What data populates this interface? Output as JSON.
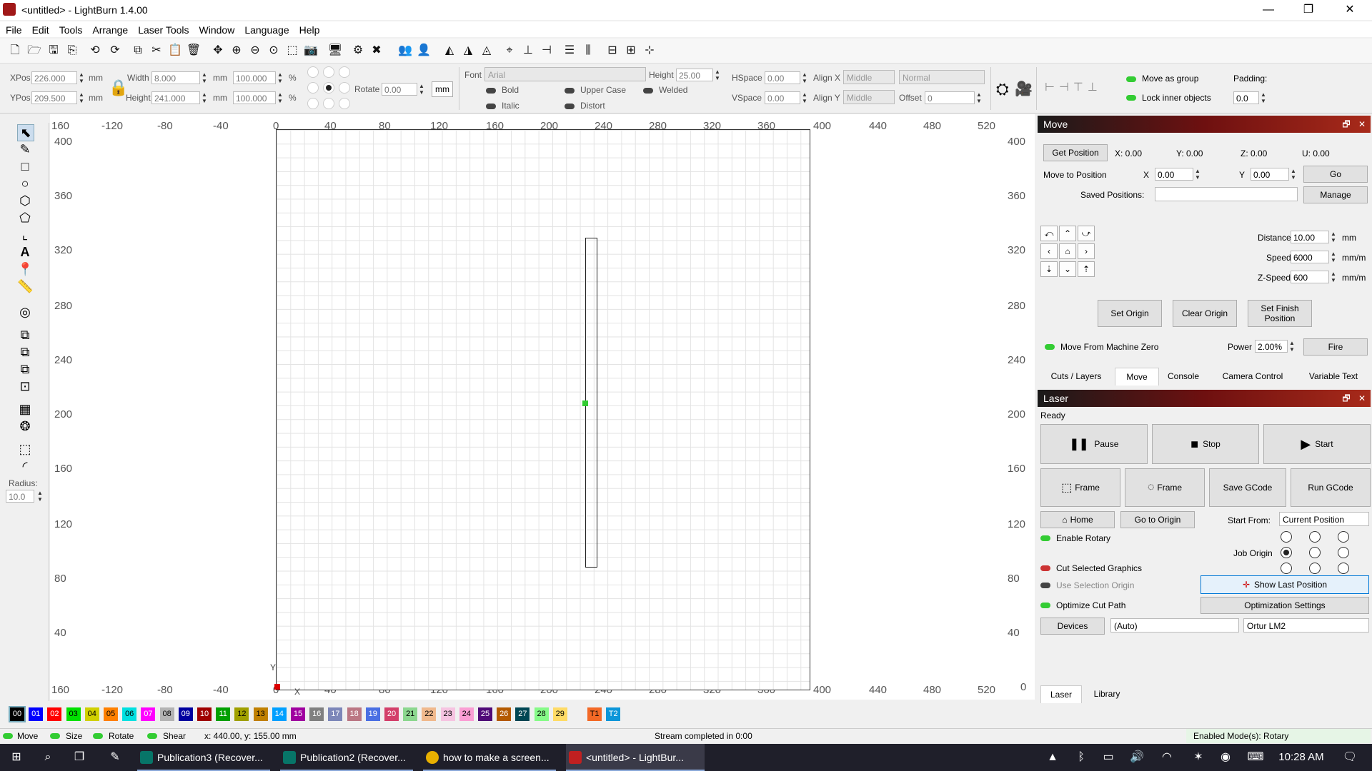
{
  "window": {
    "title": "<untitled> - LightBurn 1.4.00",
    "minimize": "—",
    "maximize": "❐",
    "close": "✕"
  },
  "menu": [
    "File",
    "Edit",
    "Tools",
    "Arrange",
    "Laser Tools",
    "Window",
    "Language",
    "Help"
  ],
  "props": {
    "xpos_label": "XPos",
    "xpos": "226.000",
    "ypos_label": "YPos",
    "ypos": "209.500",
    "unit_mm": "mm",
    "width_label": "Width",
    "width": "8.000",
    "height_label": "Height",
    "height": "241.000",
    "w_pct": "100.000",
    "h_pct": "100.000",
    "pct": "%",
    "rotate_label": "Rotate",
    "rotate": "0.00",
    "mm_button": "mm",
    "font_label": "Font",
    "font": "Arial",
    "fheight_label": "Height",
    "fheight": "25.00",
    "bold": "Bold",
    "italic": "Italic",
    "upper": "Upper Case",
    "distort": "Distort",
    "welded": "Welded",
    "hspace_label": "HSpace",
    "hspace": "0.00",
    "vspace_label": "VSpace",
    "vspace": "0.00",
    "alignx_label": "Align X",
    "alignx": "Middle",
    "aligny_label": "Align Y",
    "aligny": "Middle",
    "normal": "Normal",
    "offset_label": "Offset",
    "offset": "0",
    "move_group": "Move as group",
    "lock_inner": "Lock inner objects",
    "padding_label": "Padding:",
    "padding": "0.0"
  },
  "lefttools": {
    "radius_label": "Radius:",
    "radius": "10.0"
  },
  "ruler": {
    "top": [
      "160",
      "-120",
      "-80",
      "-40",
      "0",
      "40",
      "80",
      "120",
      "160",
      "200",
      "240",
      "280",
      "320",
      "360",
      "400",
      "440",
      "480",
      "520"
    ],
    "left": [
      "400",
      "360",
      "320",
      "280",
      "240",
      "200",
      "160",
      "120",
      "80",
      "40"
    ],
    "right": [
      "400",
      "360",
      "320",
      "280",
      "240",
      "200",
      "160",
      "120",
      "80",
      "40",
      "0"
    ],
    "axis_y": "Y",
    "axis_x": "X"
  },
  "palette": [
    {
      "t": "00",
      "c": "#000000",
      "fg": "#ffffff"
    },
    {
      "t": "01",
      "c": "#0000ff",
      "fg": "#ffffff"
    },
    {
      "t": "02",
      "c": "#ff0000",
      "fg": "#ffffff"
    },
    {
      "t": "03",
      "c": "#00e000",
      "fg": "#000000"
    },
    {
      "t": "04",
      "c": "#d0d000",
      "fg": "#000000"
    },
    {
      "t": "05",
      "c": "#ff8000",
      "fg": "#000000"
    },
    {
      "t": "06",
      "c": "#00e0e0",
      "fg": "#000000"
    },
    {
      "t": "07",
      "c": "#ff00ff",
      "fg": "#ffffff"
    },
    {
      "t": "08",
      "c": "#b4b4b4",
      "fg": "#000000"
    },
    {
      "t": "09",
      "c": "#0000a0",
      "fg": "#ffffff"
    },
    {
      "t": "10",
      "c": "#a00000",
      "fg": "#ffffff"
    },
    {
      "t": "11",
      "c": "#00a000",
      "fg": "#ffffff"
    },
    {
      "t": "12",
      "c": "#a0a000",
      "fg": "#000000"
    },
    {
      "t": "13",
      "c": "#c08000",
      "fg": "#000000"
    },
    {
      "t": "14",
      "c": "#00a0ff",
      "fg": "#ffffff"
    },
    {
      "t": "15",
      "c": "#a000a0",
      "fg": "#ffffff"
    },
    {
      "t": "16",
      "c": "#808080",
      "fg": "#ffffff"
    },
    {
      "t": "17",
      "c": "#7d87b9",
      "fg": "#ffffff"
    },
    {
      "t": "18",
      "c": "#bb7784",
      "fg": "#ffffff"
    },
    {
      "t": "19",
      "c": "#4a6fe3",
      "fg": "#ffffff"
    },
    {
      "t": "20",
      "c": "#d33f6a",
      "fg": "#ffffff"
    },
    {
      "t": "21",
      "c": "#8cd78f",
      "fg": "#000000"
    },
    {
      "t": "22",
      "c": "#f0b98d",
      "fg": "#000000"
    },
    {
      "t": "23",
      "c": "#f6c4e1",
      "fg": "#000000"
    },
    {
      "t": "24",
      "c": "#fa9ed4",
      "fg": "#000000"
    },
    {
      "t": "25",
      "c": "#500a78",
      "fg": "#ffffff"
    },
    {
      "t": "26",
      "c": "#b45a00",
      "fg": "#ffffff"
    },
    {
      "t": "27",
      "c": "#004754",
      "fg": "#ffffff"
    },
    {
      "t": "28",
      "c": "#86fa88",
      "fg": "#000000"
    },
    {
      "t": "29",
      "c": "#ffdb66",
      "fg": "#000000"
    },
    {
      "t": "T1",
      "c": "#f36926",
      "fg": "#000000"
    },
    {
      "t": "T2",
      "c": "#0c96d9",
      "fg": "#ffffff"
    }
  ],
  "status": {
    "move": "Move",
    "size": "Size",
    "rotate": "Rotate",
    "shear": "Shear",
    "coords": "x: 440.00, y: 155.00 mm",
    "stream": "Stream completed in 0:00",
    "modes": "Enabled Mode(s): Rotary"
  },
  "move_panel": {
    "title": "Move",
    "get_position": "Get Position",
    "x": "X: 0.00",
    "y": "Y: 0.00",
    "z": "Z: 0.00",
    "u": "U: 0.00",
    "move_to": "Move to Position",
    "xl": "X",
    "xv": "0.00",
    "yl": "Y",
    "yv": "0.00",
    "go": "Go",
    "saved": "Saved Positions:",
    "manage": "Manage",
    "distance_label": "Distance",
    "distance": "10.00",
    "speed_label": "Speed",
    "speed": "6000",
    "zspeed_label": "Z-Speed",
    "zspeed": "600",
    "mm": "mm",
    "mmm": "mm/m",
    "set_origin": "Set Origin",
    "clear_origin": "Clear Origin",
    "set_finish": "Set Finish Position",
    "from_zero": "Move From Machine Zero",
    "power_label": "Power",
    "power": "2.00%",
    "fire": "Fire"
  },
  "tabs": [
    "Cuts / Layers",
    "Move",
    "Console",
    "Camera Control",
    "Variable Text"
  ],
  "laser_panel": {
    "title": "Laser",
    "state": "Ready",
    "pause": "Pause",
    "stop": "Stop",
    "start": "Start",
    "frame1": "Frame",
    "frame2": "Frame",
    "save_gcode": "Save GCode",
    "run_gcode": "Run GCode",
    "home": "Home",
    "go_origin": "Go to Origin",
    "start_from_label": "Start From:",
    "start_from": "Current Position",
    "rotary": "Enable Rotary",
    "job_origin": "Job Origin",
    "cut_selected": "Cut Selected Graphics",
    "use_sel": "Use Selection Origin",
    "show_last": "Show Last Position",
    "optimize": "Optimize Cut Path",
    "opt_settings": "Optimization Settings",
    "devices": "Devices",
    "auto": "(Auto)",
    "device": "Ortur LM2"
  },
  "bottom_tabs": [
    "Laser",
    "Library"
  ],
  "taskbar": {
    "items": [
      "Publication3 (Recover...",
      "Publication2 (Recover...",
      "how to make a screen...",
      "<untitled> - LightBur..."
    ],
    "time": "10:28 AM"
  }
}
